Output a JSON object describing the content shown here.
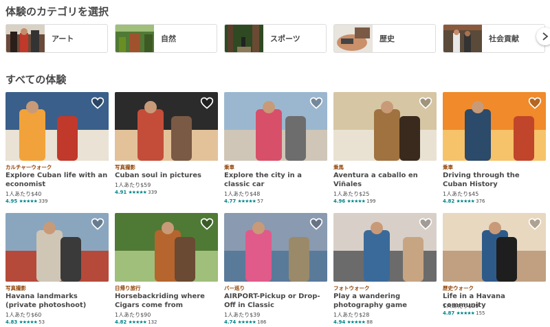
{
  "category_section": {
    "title": "体験のカテゴリを選択",
    "categories": [
      {
        "label": "アート"
      },
      {
        "label": "自然"
      },
      {
        "label": "スポーツ"
      },
      {
        "label": "歴史"
      },
      {
        "label": "社会貢献"
      }
    ],
    "next_icon": "chevron-right-icon"
  },
  "all_section": {
    "title": "すべての体験",
    "experiences": [
      {
        "category": "カルチャーウォーク",
        "title": "Explore Cuban life with an economist",
        "price": "1人あたり$40",
        "score": "4.95",
        "stars": "★★★★★",
        "reviews": "339"
      },
      {
        "category": "写真撮影",
        "title": "Cuban soul in pictures",
        "price": "1人あたり$59",
        "score": "4.91",
        "stars": "★★★★★",
        "reviews": "339"
      },
      {
        "category": "乗車",
        "title": "Explore the city in a classic car",
        "price": "1人あたり$48",
        "score": "4.77",
        "stars": "★★★★★",
        "reviews": "57"
      },
      {
        "category": "乗馬",
        "title": "Aventura a caballo en Viñales",
        "price": "1人あたり$25",
        "score": "4.96",
        "stars": "★★★★★",
        "reviews": "199"
      },
      {
        "category": "乗車",
        "title": "Driving through the Cuban History",
        "price": "1人あたり$45",
        "score": "4.82",
        "stars": "★★★★★",
        "reviews": "376"
      },
      {
        "category": "写真撮影",
        "title": "Havana landmarks (private photoshoot)",
        "price": "1人あたり$60",
        "score": "4.83",
        "stars": "★★★★★",
        "reviews": "53"
      },
      {
        "category": "日帰り旅行",
        "title": "Horsebackriding where Cigars come from",
        "price": "1人あたり$90",
        "score": "4.82",
        "stars": "★★★★★",
        "reviews": "132"
      },
      {
        "category": "バー巡り",
        "title": "AIRPORT-Pickup or Drop-Off in Classic",
        "price": "1人あたり$39",
        "score": "4.74",
        "stars": "★★★★★",
        "reviews": "186"
      },
      {
        "category": "フォトウォーク",
        "title": "Play a wandering photography game",
        "price": "1人あたり$28",
        "score": "4.94",
        "stars": "★★★★★",
        "reviews": "88"
      },
      {
        "category": "歴史ウォーク",
        "title": "Life in a Havana community",
        "price": "1人あたり$29",
        "score": "4.87",
        "stars": "★★★★★",
        "reviews": "155"
      }
    ]
  },
  "colors": {
    "accent_teal": "#008489",
    "category_brown": "#8f3f00",
    "text": "#484848"
  }
}
